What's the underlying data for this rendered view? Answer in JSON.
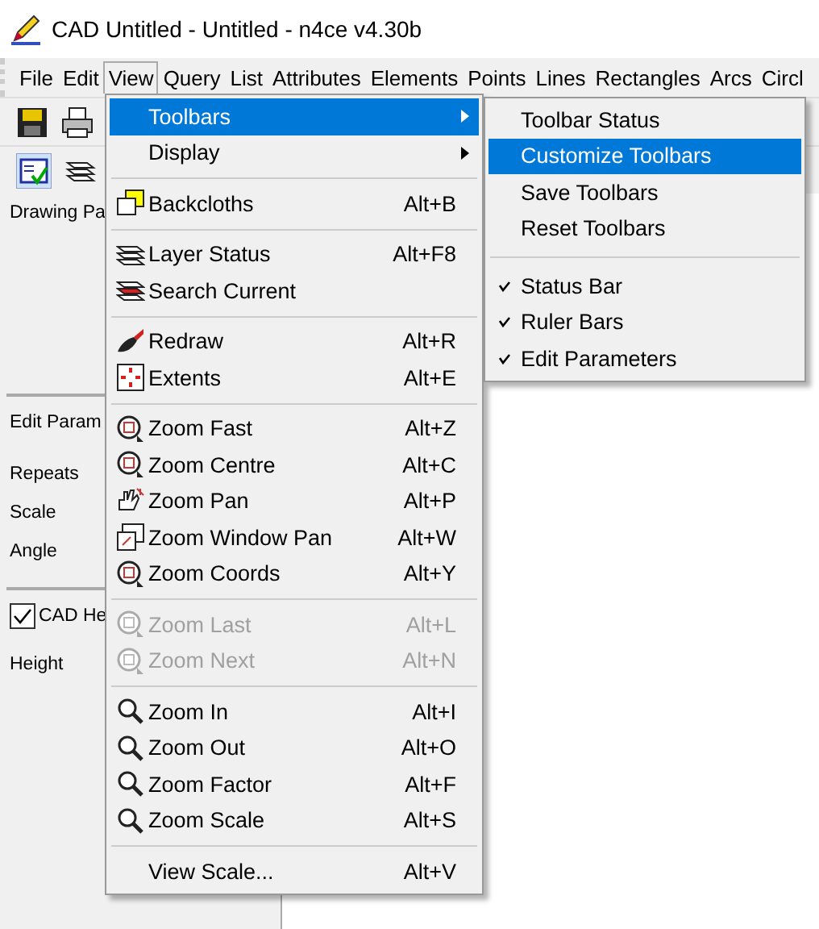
{
  "window": {
    "title": "CAD Untitled - Untitled - n4ce v4.30b"
  },
  "menubar": [
    {
      "label": "File",
      "selected": false
    },
    {
      "label": "Edit",
      "selected": false
    },
    {
      "label": "View",
      "selected": true
    },
    {
      "label": "Query",
      "selected": false
    },
    {
      "label": "List",
      "selected": false
    },
    {
      "label": "Attributes",
      "selected": false
    },
    {
      "label": "Elements",
      "selected": false
    },
    {
      "label": "Points",
      "selected": false
    },
    {
      "label": "Lines",
      "selected": false
    },
    {
      "label": "Rectangles",
      "selected": false
    },
    {
      "label": "Arcs",
      "selected": false
    },
    {
      "label": "Circl",
      "selected": false
    }
  ],
  "left_panel": {
    "drawing_header": "Drawing Pa",
    "edit_header": "Edit Param",
    "fields": [
      "Repeats",
      "Scale",
      "Angle"
    ],
    "checkbox": {
      "label": "CAD He",
      "checked": true
    },
    "height_label": "Height"
  },
  "view_menu": [
    [
      {
        "label": "Toolbars",
        "submenu": true,
        "selected": true,
        "disabled": false
      },
      {
        "label": "Display",
        "submenu": true,
        "selected": false,
        "disabled": false
      }
    ],
    [
      {
        "label": "Backcloths",
        "shortcut": "Alt+B",
        "submenu": false,
        "selected": false,
        "disabled": false
      }
    ],
    [
      {
        "label": "Layer Status",
        "shortcut": "Alt+F8",
        "submenu": false,
        "selected": false,
        "disabled": false
      },
      {
        "label": "Search Current",
        "submenu": false,
        "selected": false,
        "disabled": false
      }
    ],
    [
      {
        "label": "Redraw",
        "shortcut": "Alt+R",
        "submenu": false,
        "selected": false,
        "disabled": false
      },
      {
        "label": "Extents",
        "shortcut": "Alt+E",
        "submenu": false,
        "selected": false,
        "disabled": false
      }
    ],
    [
      {
        "label": "Zoom Fast",
        "shortcut": "Alt+Z",
        "submenu": false,
        "selected": false,
        "disabled": false
      },
      {
        "label": "Zoom Centre",
        "shortcut": "Alt+C",
        "submenu": false,
        "selected": false,
        "disabled": false
      },
      {
        "label": "Zoom Pan",
        "shortcut": "Alt+P",
        "submenu": false,
        "selected": false,
        "disabled": false
      },
      {
        "label": "Zoom Window Pan",
        "shortcut": "Alt+W",
        "submenu": false,
        "selected": false,
        "disabled": false
      },
      {
        "label": "Zoom Coords",
        "shortcut": "Alt+Y",
        "submenu": false,
        "selected": false,
        "disabled": false
      }
    ],
    [
      {
        "label": "Zoom Last",
        "shortcut": "Alt+L",
        "submenu": false,
        "selected": false,
        "disabled": true
      },
      {
        "label": "Zoom Next",
        "shortcut": "Alt+N",
        "submenu": false,
        "selected": false,
        "disabled": true
      }
    ],
    [
      {
        "label": "Zoom In",
        "shortcut": "Alt+I",
        "submenu": false,
        "selected": false,
        "disabled": false
      },
      {
        "label": "Zoom Out",
        "shortcut": "Alt+O",
        "submenu": false,
        "selected": false,
        "disabled": false
      },
      {
        "label": "Zoom Factor",
        "shortcut": "Alt+F",
        "submenu": false,
        "selected": false,
        "disabled": false
      },
      {
        "label": "Zoom Scale",
        "shortcut": "Alt+S",
        "submenu": false,
        "selected": false,
        "disabled": false
      }
    ],
    [
      {
        "label": "View Scale...",
        "shortcut": "Alt+V",
        "submenu": false,
        "selected": false,
        "disabled": false
      }
    ]
  ],
  "toolbars_submenu": [
    [
      {
        "label": "Toolbar Status",
        "checked": false,
        "selected": false
      },
      {
        "label": "Customize Toolbars",
        "checked": false,
        "selected": true
      },
      {
        "label": "Save Toolbars",
        "checked": false,
        "selected": false
      },
      {
        "label": "Reset Toolbars",
        "checked": false,
        "selected": false
      }
    ],
    [
      {
        "label": "Status Bar",
        "checked": true,
        "selected": false
      },
      {
        "label": "Ruler Bars",
        "checked": true,
        "selected": false
      },
      {
        "label": "Edit Parameters",
        "checked": true,
        "selected": false
      }
    ]
  ]
}
